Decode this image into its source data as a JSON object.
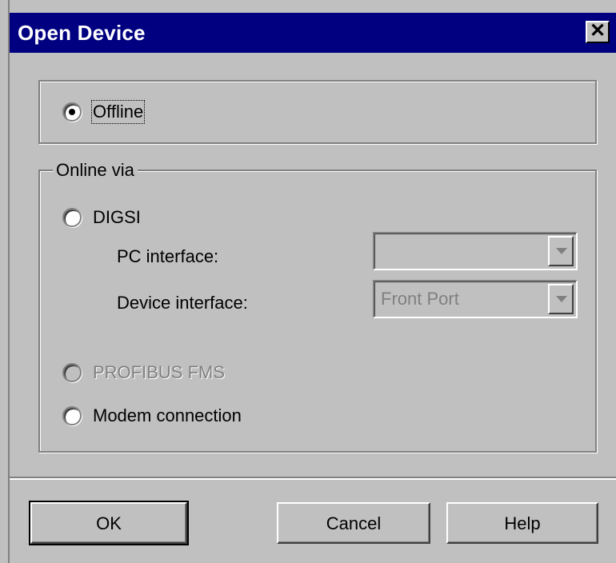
{
  "window": {
    "title": "Open Device",
    "close_glyph": "✕"
  },
  "offline_group": {
    "offline_label": "Offline",
    "offline_selected": true
  },
  "online_group": {
    "legend": "Online via",
    "digsi_label": "DIGSI",
    "pc_interface": {
      "label": "PC interface:",
      "value": ""
    },
    "device_interface": {
      "label": "Device interface:",
      "value": "Front Port"
    },
    "profibus_label": "PROFIBUS FMS",
    "modem_label": "Modem connection"
  },
  "buttons": {
    "ok": "OK",
    "cancel": "Cancel",
    "help": "Help"
  }
}
